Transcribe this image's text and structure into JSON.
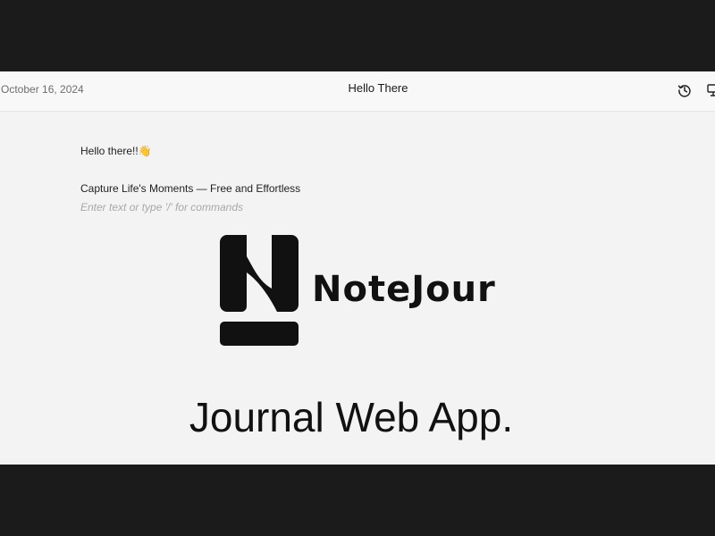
{
  "header": {
    "date": "October 16, 2024",
    "title": "Hello There",
    "icons": [
      "history-icon",
      "share-icon"
    ]
  },
  "editor": {
    "greeting": "Hello there!!👋",
    "tagline": "Capture Life's Moments — Free and Effortless",
    "placeholder": "Enter text or type '/' for commands"
  },
  "branding": {
    "logo_name": "NoteJour",
    "subtitle": "Journal Web App."
  },
  "colors": {
    "page_background": "#1b1b1c",
    "window_background": "#f3f3f3",
    "header_background": "#f8f8f8",
    "text": "#1f1f1f",
    "muted_text": "#6e6e6e",
    "placeholder_text": "#a8a8a8",
    "logo": "#111111"
  }
}
